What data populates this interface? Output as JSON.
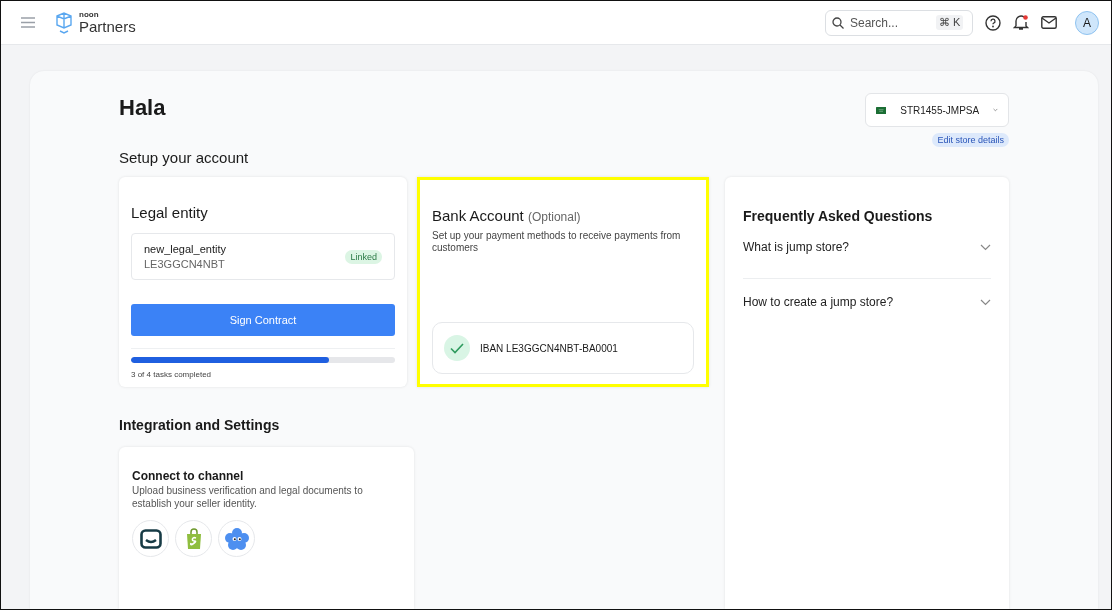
{
  "header": {
    "brand_small": "noon",
    "brand": "Partners",
    "search": {
      "placeholder": "Search...",
      "shortcut": "⌘ K"
    },
    "avatar": "A"
  },
  "page": {
    "greeting": "Hala",
    "store": {
      "name": "STR1455-JMPSA",
      "edit_link": "Edit store details"
    }
  },
  "setup": {
    "title": "Setup your account",
    "legal_entity": {
      "title": "Legal entity",
      "entity_name": "new_legal_entity",
      "entity_id": "LE3GGCN4NBT",
      "badge": "Linked",
      "button": "Sign Contract",
      "progress": {
        "level": 0.75,
        "label": "3 of 4 tasks completed"
      }
    },
    "bank_account": {
      "title": "Bank Account",
      "optional": "(Optional)",
      "description": "Set up your payment methods to receive payments from customers",
      "iban": "IBAN LE3GGCN4NBT-BA0001"
    }
  },
  "faq": {
    "title": "Frequently Asked Questions",
    "items": [
      {
        "question": "What is jump store?"
      },
      {
        "question": "How to create a jump store?"
      }
    ]
  },
  "integration": {
    "title": "Integration and Settings",
    "card": {
      "title": "Connect to channel",
      "description": "Upload business verification and legal documents to establish your seller identity."
    }
  }
}
